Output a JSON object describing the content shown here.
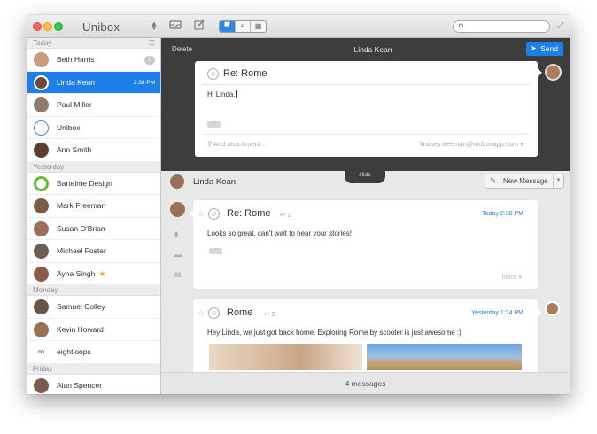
{
  "window": {
    "app_name": "Unibox"
  },
  "sidebar": {
    "sections": [
      {
        "label": "Today",
        "items": [
          {
            "name": "Beth Harris",
            "badge": "1"
          },
          {
            "name": "Linda Kean",
            "time": "2:38 PM",
            "selected": true
          },
          {
            "name": "Paul Miller"
          },
          {
            "name": "Unibox"
          },
          {
            "name": "Ann Smith"
          }
        ]
      },
      {
        "label": "Yesterday",
        "items": [
          {
            "name": "Bartelme Design"
          },
          {
            "name": "Mark Freeman"
          },
          {
            "name": "Susan O'Brian"
          },
          {
            "name": "Michael Foster"
          },
          {
            "name": "Ayna Singh",
            "starred": true
          }
        ]
      },
      {
        "label": "Monday",
        "items": [
          {
            "name": "Samuel Colley"
          },
          {
            "name": "Kevin Howard"
          },
          {
            "name": "eightloops"
          }
        ]
      },
      {
        "label": "Friday",
        "items": [
          {
            "name": "Alan Spencer"
          }
        ]
      }
    ]
  },
  "compose": {
    "delete_label": "Delete",
    "to_name": "Linda Kean",
    "send_label": "Send",
    "subject": "Re: Rome",
    "body": "Hi Linda,",
    "attach_label": "Add attachment...",
    "from_address": "lindsey.freeman@uniboxapp.com",
    "hide_label": "Hide"
  },
  "conversation": {
    "name": "Linda Kean",
    "new_message_label": "New Message",
    "messages": [
      {
        "subject": "Re: Rome",
        "count": "2",
        "date": "Today 2:38 PM",
        "body": "Looks so great, can't wait to hear your stories!",
        "folder": "Inbox"
      },
      {
        "subject": "Rome",
        "count": "2",
        "date": "Yesterday 1:24 PM",
        "body": "Hey Linda, we just got back home. Exploring Rome by scooter is just awesome :)"
      }
    ],
    "footer": "4 messages"
  },
  "colors": {
    "accent": "#1e7fea",
    "compose_bg": "#3d3d3d"
  }
}
